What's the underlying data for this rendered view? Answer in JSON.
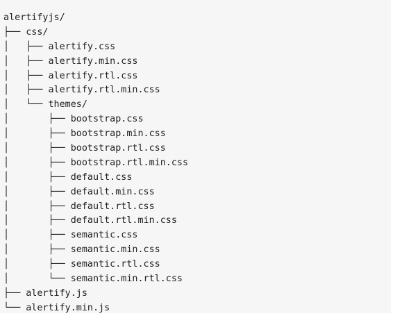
{
  "tree": {
    "lines": [
      {
        "prefix": "",
        "name": "alertifyjs/"
      },
      {
        "prefix": "├── ",
        "name": "css/"
      },
      {
        "prefix": "│   ├── ",
        "name": "alertify.css"
      },
      {
        "prefix": "│   ├── ",
        "name": "alertify.min.css"
      },
      {
        "prefix": "│   ├── ",
        "name": "alertify.rtl.css"
      },
      {
        "prefix": "│   ├── ",
        "name": "alertify.rtl.min.css"
      },
      {
        "prefix": "│   └── ",
        "name": "themes/"
      },
      {
        "prefix": "│       ├── ",
        "name": "bootstrap.css"
      },
      {
        "prefix": "│       ├── ",
        "name": "bootstrap.min.css"
      },
      {
        "prefix": "│       ├── ",
        "name": "bootstrap.rtl.css"
      },
      {
        "prefix": "│       ├── ",
        "name": "bootstrap.rtl.min.css"
      },
      {
        "prefix": "│       ├── ",
        "name": "default.css"
      },
      {
        "prefix": "│       ├── ",
        "name": "default.min.css"
      },
      {
        "prefix": "│       ├── ",
        "name": "default.rtl.css"
      },
      {
        "prefix": "│       ├── ",
        "name": "default.rtl.min.css"
      },
      {
        "prefix": "│       ├── ",
        "name": "semantic.css"
      },
      {
        "prefix": "│       ├── ",
        "name": "semantic.min.css"
      },
      {
        "prefix": "│       ├── ",
        "name": "semantic.rtl.css"
      },
      {
        "prefix": "│       └── ",
        "name": "semantic.min.rtl.css"
      },
      {
        "prefix": "├── ",
        "name": "alertify.js"
      },
      {
        "prefix": "└── ",
        "name": "alertify.min.js"
      }
    ]
  }
}
